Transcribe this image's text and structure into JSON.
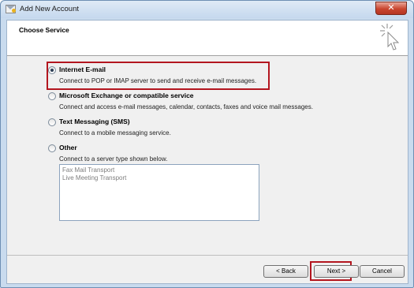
{
  "window": {
    "title": "Add New Account",
    "close_glyph": "✕"
  },
  "header": {
    "title": "Choose Service",
    "icon": "cursor-sparkle-icon"
  },
  "options": [
    {
      "label": "Internet E-mail",
      "description": "Connect to POP or IMAP server to send and receive e-mail messages.",
      "selected": true
    },
    {
      "label": "Microsoft Exchange or compatible service",
      "description": "Connect and access e-mail messages, calendar, contacts, faxes and voice mail messages.",
      "selected": false
    },
    {
      "label": "Text Messaging (SMS)",
      "description": "Connect to a mobile messaging service.",
      "selected": false
    },
    {
      "label": "Other",
      "description": "Connect to a server type shown below.",
      "selected": false
    }
  ],
  "server_types": [
    "Fax Mail Transport",
    "Live Meeting Transport"
  ],
  "buttons": {
    "back": "< Back",
    "next": "Next >",
    "cancel": "Cancel"
  },
  "colors": {
    "highlight": "#b3161f",
    "title_bar": "#c5d8ee",
    "close_button": "#c9452f"
  }
}
